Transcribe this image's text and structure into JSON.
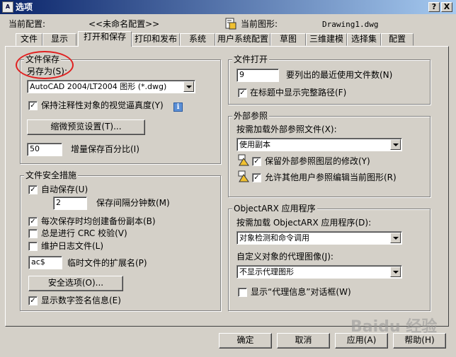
{
  "window": {
    "title": "选项",
    "help_btn": "?",
    "close_btn": "X"
  },
  "header": {
    "profile_label": "当前配置:",
    "profile_value": "<<未命名配置>>",
    "drawing_label": "当前图形:",
    "drawing_value": "Drawing1.dwg"
  },
  "tabs": [
    "文件",
    "显示",
    "打开和保存",
    "打印和发布",
    "系统",
    "用户系统配置",
    "草图",
    "三维建模",
    "选择集",
    "配置"
  ],
  "active_tab": "打开和保存",
  "file_save": {
    "legend": "文件保存",
    "save_as_label": "另存为(S):",
    "save_as_value": "AutoCAD 2004/LT2004 图形 (*.dwg)",
    "keep_visual_fidelity": "保持注释性对象的视觉逼真度(Y)",
    "keep_visual_fidelity_checked": true,
    "thumbnail_button": "缩微预览设置(T)...",
    "incremental_value": "50",
    "incremental_label": "增量保存百分比(I)"
  },
  "file_safety": {
    "legend": "文件安全措施",
    "autosave_label": "自动保存(U)",
    "autosave_checked": true,
    "interval_value": "2",
    "interval_label": "保存间隔分钟数(M)",
    "backup_label": "每次保存时均创建备份副本(B)",
    "backup_checked": true,
    "crc_label": "总是进行 CRC 校验(V)",
    "crc_checked": false,
    "log_label": "维护日志文件(L)",
    "log_checked": false,
    "ext_value": "ac$",
    "ext_label": "临时文件的扩展名(P)",
    "security_button": "安全选项(O)...",
    "signature_label": "显示数字签名信息(E)",
    "signature_checked": true
  },
  "file_open": {
    "legend": "文件打开",
    "recent_value": "9",
    "recent_label": "要列出的最近使用文件数(N)",
    "fullpath_label": "在标题中显示完整路径(F)",
    "fullpath_checked": true
  },
  "xref": {
    "legend": "外部参照",
    "demand_label": "按需加载外部参照文件(X):",
    "demand_value": "使用副本",
    "retain_label": "保留外部参照图层的修改(Y)",
    "retain_checked": true,
    "allow_label": "允许其他用户参照编辑当前图形(R)",
    "allow_checked": true
  },
  "arx": {
    "legend": "ObjectARX 应用程序",
    "demand_label": "按需加载 ObjectARX 应用程序(D):",
    "demand_value": "对象检测和命令调用",
    "proxy_label": "自定义对象的代理图像(J):",
    "proxy_value": "不显示代理图形",
    "proxy_dialog_label": "显示“代理信息”对话框(W)",
    "proxy_dialog_checked": false
  },
  "footer": {
    "ok": "确定",
    "cancel": "取消",
    "apply": "应用(A)",
    "help": "帮助(H)"
  },
  "watermark": "Baidu 经验",
  "check_glyph": "✓"
}
